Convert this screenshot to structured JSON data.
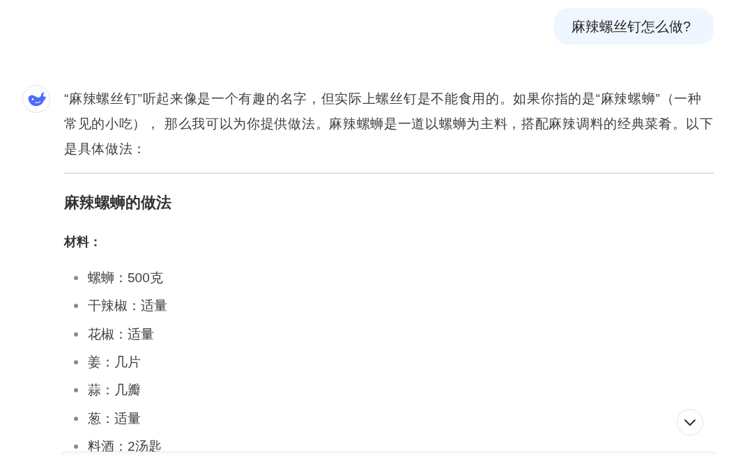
{
  "user_message": {
    "text": "麻辣螺丝钉怎么做?"
  },
  "assistant_reply": {
    "blocks": [
      {
        "kind": "paragraph",
        "text": "“麻辣螺丝钉”听起来像是一个有趣的名字，但实际上螺丝钉是不能食用的。如果你指的是“麻辣螺蛳”（一种常见的小吃）， 那么我可以为你提供做法。麻辣螺蛳是一道以螺蛳为主料，搭配麻辣调料的经典菜肴。以下是具体做法："
      },
      {
        "kind": "rule"
      },
      {
        "kind": "heading",
        "text": "麻辣螺蛳的做法"
      },
      {
        "kind": "label",
        "text": "材料："
      },
      {
        "kind": "list",
        "items": [
          "螺蛳：500克",
          "干辣椒：适量",
          "花椒：适量",
          "姜：几片",
          "蒜：几瓣",
          "葱：适量",
          "料酒：2汤匙"
        ]
      }
    ]
  }
}
